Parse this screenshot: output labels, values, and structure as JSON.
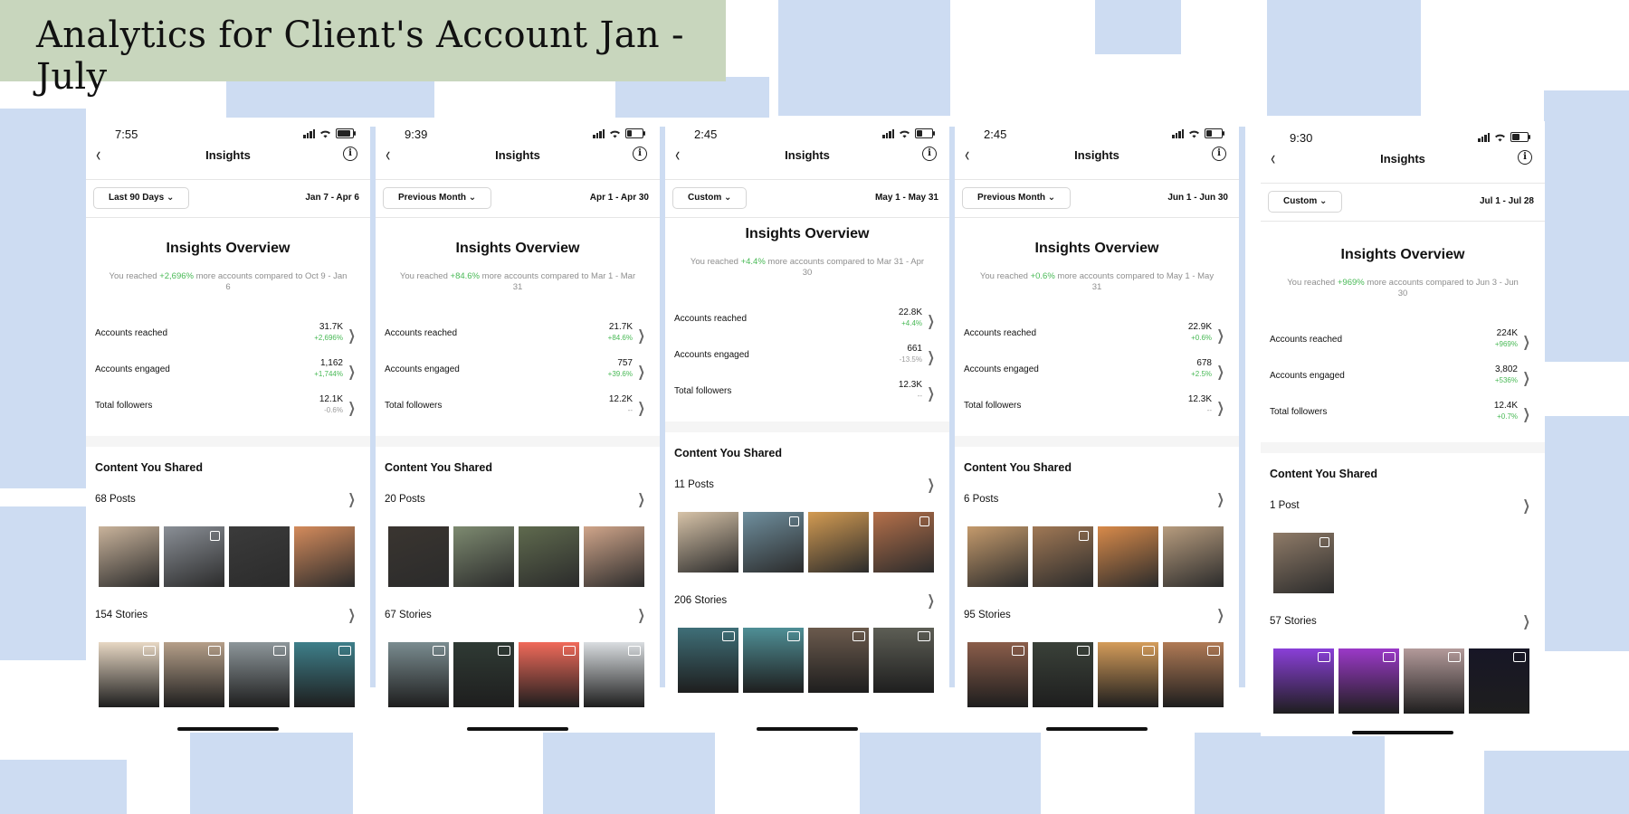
{
  "banner": {
    "title": "Analytics for Client's Account Jan - July"
  },
  "colors": {
    "banner_bg": "#c8d6bd",
    "pattern": "#cddcf2",
    "positive": "#48b955",
    "neutral": "#9a9a9a"
  },
  "screens": [
    {
      "time": "7:55",
      "battery": 0.95,
      "nav_title": "Insights",
      "filter": "Last 90 Days",
      "date_range": "Jan 7 - Apr 6",
      "overview_title": "Insights Overview",
      "reached_prefix": "You reached ",
      "reached_pct": "+2,696%",
      "reached_suffix": " more accounts compared to Oct 9 - Jan 6",
      "metrics": [
        {
          "label": "Accounts reached",
          "value": "31.7K",
          "change": "+2,696%",
          "trend": "up"
        },
        {
          "label": "Accounts engaged",
          "value": "1,162",
          "change": "+1,744%",
          "trend": "up"
        },
        {
          "label": "Total followers",
          "value": "12.1K",
          "change": "-0.6%",
          "trend": "down"
        }
      ],
      "content_title": "Content You Shared",
      "posts_label": "68 Posts",
      "stories_label": "154 Stories"
    },
    {
      "time": "9:39",
      "battery": 0.3,
      "nav_title": "Insights",
      "filter": "Previous Month",
      "date_range": "Apr 1 - Apr 30",
      "overview_title": "Insights Overview",
      "reached_prefix": "You reached ",
      "reached_pct": "+84.6%",
      "reached_suffix": " more accounts compared to Mar 1 - Mar 31",
      "metrics": [
        {
          "label": "Accounts reached",
          "value": "21.7K",
          "change": "+84.6%",
          "trend": "up"
        },
        {
          "label": "Accounts engaged",
          "value": "757",
          "change": "+39.6%",
          "trend": "up"
        },
        {
          "label": "Total followers",
          "value": "12.2K",
          "change": "--",
          "trend": "flat"
        }
      ],
      "content_title": "Content You Shared",
      "posts_label": "20 Posts",
      "stories_label": "67 Stories"
    },
    {
      "time": "2:45",
      "battery": 0.4,
      "nav_title": "Insights",
      "filter": "Custom",
      "date_range": "May 1 - May 31",
      "overview_title": "Insights Overview",
      "reached_prefix": "You reached ",
      "reached_pct": "+4.4%",
      "reached_suffix": " more accounts compared to Mar 31 - Apr 30",
      "metrics": [
        {
          "label": "Accounts reached",
          "value": "22.8K",
          "change": "+4.4%",
          "trend": "up"
        },
        {
          "label": "Accounts engaged",
          "value": "661",
          "change": "-13.5%",
          "trend": "down"
        },
        {
          "label": "Total followers",
          "value": "12.3K",
          "change": "--",
          "trend": "flat"
        }
      ],
      "content_title": "Content You Shared",
      "posts_label": "11 Posts",
      "stories_label": "206 Stories"
    },
    {
      "time": "2:45",
      "battery": 0.4,
      "nav_title": "Insights",
      "filter": "Previous Month",
      "date_range": "Jun 1 - Jun 30",
      "overview_title": "Insights Overview",
      "reached_prefix": "You reached ",
      "reached_pct": "+0.6%",
      "reached_suffix": " more accounts compared to May 1 - May 31",
      "metrics": [
        {
          "label": "Accounts reached",
          "value": "22.9K",
          "change": "+0.6%",
          "trend": "up"
        },
        {
          "label": "Accounts engaged",
          "value": "678",
          "change": "+2.5%",
          "trend": "up"
        },
        {
          "label": "Total followers",
          "value": "12.3K",
          "change": "--",
          "trend": "flat"
        }
      ],
      "content_title": "Content You Shared",
      "posts_label": "6 Posts",
      "stories_label": "95 Stories"
    },
    {
      "time": "9:30",
      "battery": 0.55,
      "nav_title": "Insights",
      "filter": "Custom",
      "date_range": "Jul 1 - Jul 28",
      "overview_title": "Insights Overview",
      "reached_prefix": "You reached ",
      "reached_pct": "+969%",
      "reached_suffix": " more accounts compared to Jun 3 - Jun 30",
      "metrics": [
        {
          "label": "Accounts reached",
          "value": "224K",
          "change": "+969%",
          "trend": "up"
        },
        {
          "label": "Accounts engaged",
          "value": "3,802",
          "change": "+536%",
          "trend": "up"
        },
        {
          "label": "Total followers",
          "value": "12.4K",
          "change": "+0.7%",
          "trend": "up"
        }
      ],
      "content_title": "Content You Shared",
      "posts_label": "1 Post",
      "stories_label": "57 Stories"
    }
  ]
}
